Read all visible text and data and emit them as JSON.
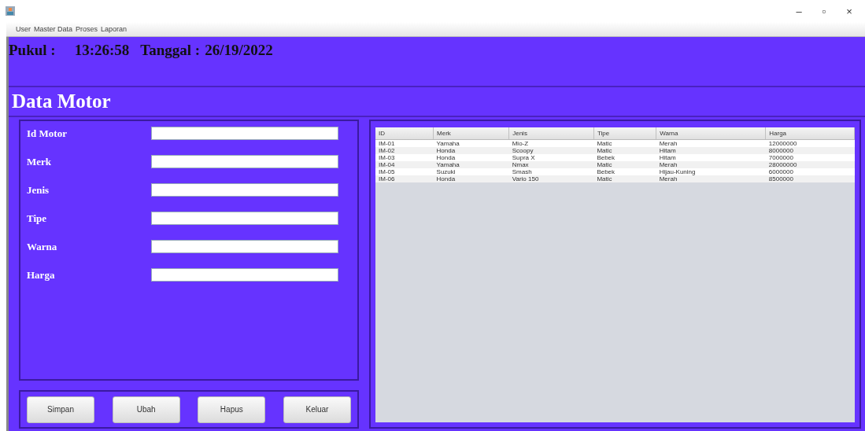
{
  "window": {
    "controls": [
      "–",
      "▫",
      "×"
    ]
  },
  "menu": [
    "User",
    "Master Data",
    "Proses",
    "Laporan"
  ],
  "header": {
    "time_label": "Pukul :",
    "time": "13:26:58",
    "date_label": "Tanggal :",
    "date": "26/19/2022"
  },
  "title": "Data Motor",
  "form": [
    {
      "label": "Id Motor"
    },
    {
      "label": "Merk"
    },
    {
      "label": "Jenis"
    },
    {
      "label": "Tipe"
    },
    {
      "label": "Warna"
    },
    {
      "label": "Harga"
    }
  ],
  "buttons": [
    "Simpan",
    "Ubah",
    "Hapus",
    "Keluar"
  ],
  "table": {
    "columns": [
      "ID",
      "Merk",
      "Jenis",
      "Tipe",
      "Warna",
      "Harga"
    ],
    "rows": [
      [
        "IM-01",
        "Yamaha",
        "Mio-Z",
        "Matic",
        "Merah",
        "12000000"
      ],
      [
        "IM-02",
        "Honda",
        "Scoopy",
        "Matic",
        "Hitam",
        "8000000"
      ],
      [
        "IM-03",
        "Honda",
        "Supra X",
        "Bebek",
        "Hitam",
        "7000000"
      ],
      [
        "IM-04",
        "Yamaha",
        "Nmax",
        "Matic",
        "Merah",
        "28000000"
      ],
      [
        "IM-05",
        "Suzuki",
        "Smash",
        "Bebek",
        "Hijau-Kuning",
        "6000000"
      ],
      [
        "IM-06",
        "Honda",
        "Vario 150",
        "Matic",
        "Merah",
        "8500000"
      ]
    ]
  }
}
